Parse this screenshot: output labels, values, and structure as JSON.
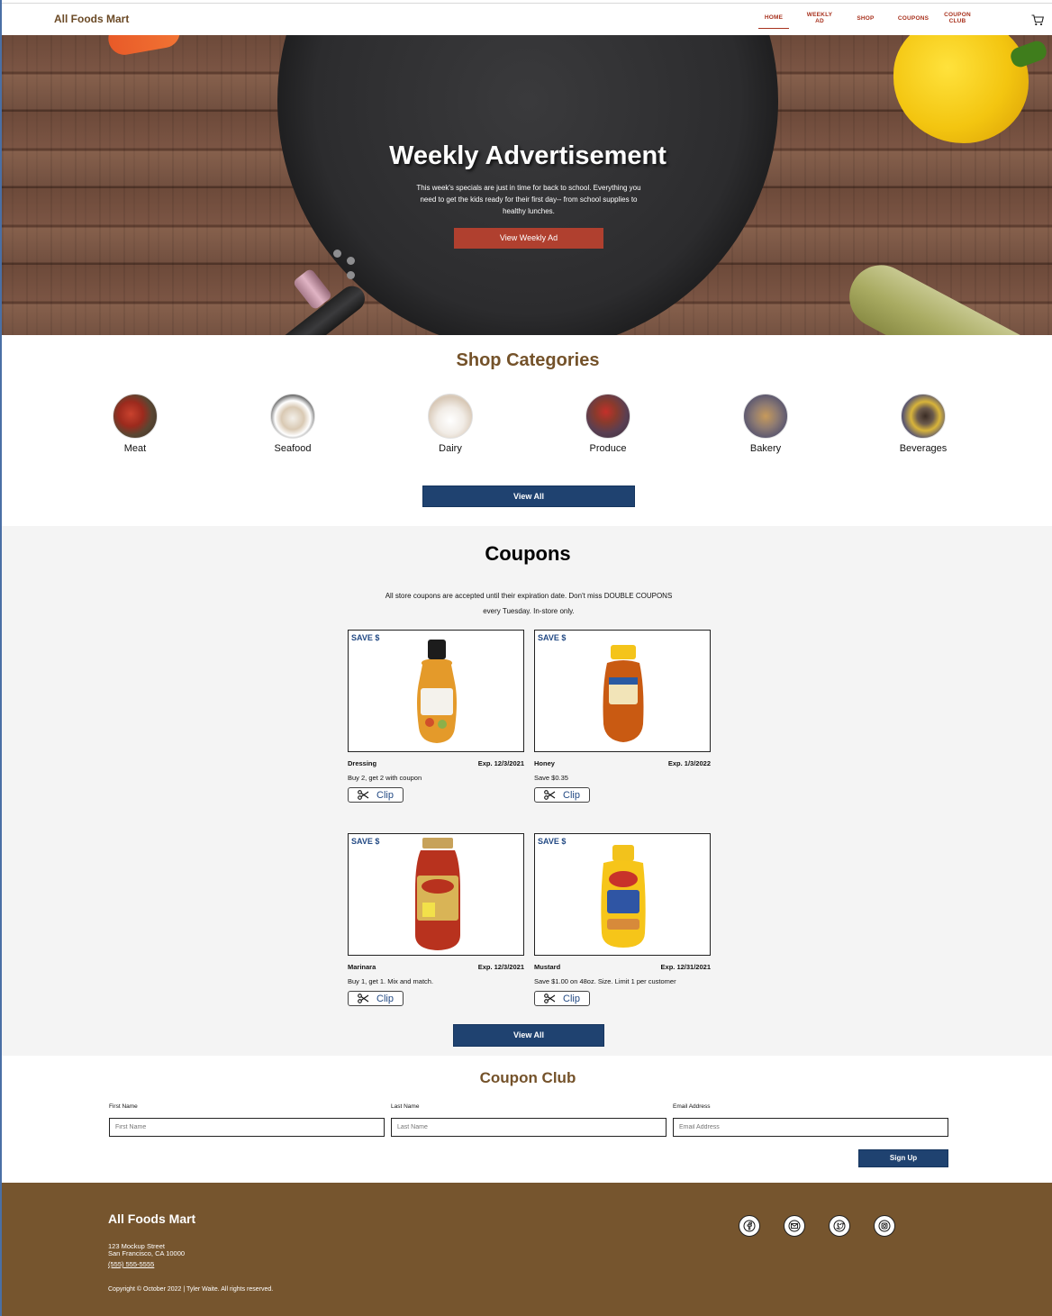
{
  "header": {
    "brand": "All Foods Mart",
    "nav": [
      {
        "label": "HOME",
        "active": true
      },
      {
        "label": "WEEKLY AD",
        "active": false
      },
      {
        "label": "SHOP",
        "active": false
      },
      {
        "label": "COUPONS",
        "active": false
      },
      {
        "label": "COUPON CLUB",
        "active": false
      }
    ],
    "cart_icon": "cart-icon"
  },
  "hero": {
    "title": "Weekly Advertisement",
    "text": "This week's specials are just in time for back to school. Everything you need to get the kids ready for their first day-- from school supplies to healthy lunches.",
    "button": "View Weekly Ad"
  },
  "categories": {
    "title": "Shop Categories",
    "items": [
      {
        "label": "Meat"
      },
      {
        "label": "Seafood"
      },
      {
        "label": "Dairy"
      },
      {
        "label": "Produce"
      },
      {
        "label": "Bakery"
      },
      {
        "label": "Beverages"
      }
    ],
    "view_all": "View All"
  },
  "coupons": {
    "title": "Coupons",
    "description": "All store coupons are accepted until their expiration date. Don't miss DOUBLE COUPONS every Tuesday. In-store only.",
    "save_label": "SAVE $",
    "clip_label": "Clip",
    "items": [
      {
        "name": "Dressing",
        "expiry": "Exp. 12/3/2021",
        "offer": "Buy 2, get 2 with coupon"
      },
      {
        "name": "Honey",
        "expiry": "Exp. 1/3/2022",
        "offer": "Save $0.35"
      },
      {
        "name": "Marinara",
        "expiry": "Exp. 12/3/2021",
        "offer": "Buy 1, get 1. Mix and match."
      },
      {
        "name": "Mustard",
        "expiry": "Exp. 12/31/2021",
        "offer": "Save $1.00 on 48oz. Size. Limit 1 per customer"
      }
    ],
    "view_all": "View All"
  },
  "club": {
    "title": "Coupon Club",
    "fields": [
      {
        "label": "First Name",
        "placeholder": "First Name"
      },
      {
        "label": "Last Name",
        "placeholder": "Last Name"
      },
      {
        "label": "Email Address",
        "placeholder": "Email Address"
      }
    ],
    "signup": "Sign Up"
  },
  "footer": {
    "brand": "All Foods Mart",
    "address_line1": "123 Mockup Street",
    "address_line2": "San Francisco, CA 10000",
    "phone": "(555) 555-5555",
    "copyright": "Copyright © October 2022 | Tyler Waite. All rights reserved.",
    "social_icons": [
      "facebook-icon",
      "mail-icon",
      "twitter-icon",
      "instagram-icon"
    ]
  },
  "colors": {
    "brand_brown": "#74522a",
    "nav_red": "#a8321e",
    "hero_button": "#b0402f",
    "navy": "#1f4270",
    "footer_bg": "#76552e"
  }
}
